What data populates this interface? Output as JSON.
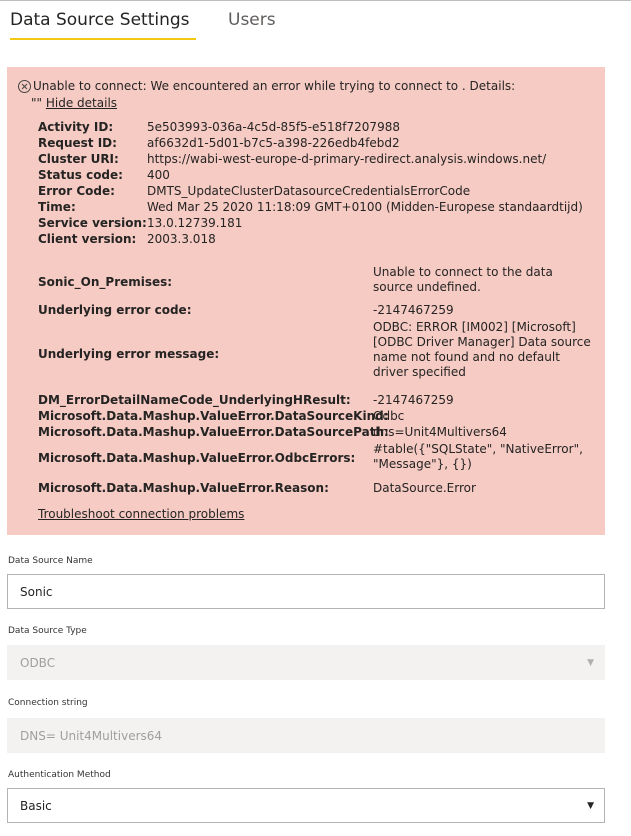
{
  "tabs": [
    {
      "label": "Data Source Settings",
      "active": true
    },
    {
      "label": "Users",
      "active": false
    }
  ],
  "error": {
    "message_line1": "Unable to connect: We encountered an error while trying to connect to . Details:",
    "message_line2_prefix": "\"\"",
    "hide_details": "Hide details",
    "fields": [
      {
        "label": "Activity ID:",
        "value": "5e503993-036a-4c5d-85f5-e518f7207988"
      },
      {
        "label": "Request ID:",
        "value": "af6632d1-5d01-b7c5-a398-226edb4febd2"
      },
      {
        "label": "Cluster URI:",
        "value": "https://wabi-west-europe-d-primary-redirect.analysis.windows.net/"
      },
      {
        "label": "Status code:",
        "value": "400"
      },
      {
        "label": "Error Code:",
        "value": "DMTS_UpdateClusterDatasourceCredentialsErrorCode"
      },
      {
        "label": "Time:",
        "value": "Wed Mar 25 2020 11:18:09 GMT+0100 (Midden-Europese standaardtijd)"
      },
      {
        "label": "Service version:",
        "value": "13.0.12739.181"
      },
      {
        "label": "Client version:",
        "value": "2003.3.018"
      }
    ],
    "details": [
      {
        "label": "Sonic_On_Premises:",
        "value": "Unable to connect to the data source undefined."
      },
      {
        "label": "Underlying error code:",
        "value": "-2147467259"
      },
      {
        "label": "Underlying error message:",
        "value": "ODBC: ERROR [IM002] [Microsoft] [ODBC Driver Manager] Data source name not found and no default driver specified"
      },
      {
        "label": "DM_ErrorDetailNameCode_UnderlyingHResult:",
        "value": "-2147467259"
      },
      {
        "label": "Microsoft.Data.Mashup.ValueError.DataSourceKind:",
        "value": "Odbc"
      },
      {
        "label": "Microsoft.Data.Mashup.ValueError.DataSourcePath:",
        "value": "dns=Unit4Multivers64"
      },
      {
        "label": "Microsoft.Data.Mashup.ValueError.OdbcErrors:",
        "value": "#table({\"SQLState\", \"NativeError\", \"Message\"}, {})"
      },
      {
        "label": "Microsoft.Data.Mashup.ValueError.Reason:",
        "value": "DataSource.Error"
      }
    ],
    "troubleshoot": "Troubleshoot connection problems"
  },
  "form": {
    "data_source_name": {
      "label": "Data Source Name",
      "value": "Sonic"
    },
    "data_source_type": {
      "label": "Data Source Type",
      "value": "ODBC"
    },
    "connection_string": {
      "label": "Connection string",
      "value": "DNS= Unit4Multivers64"
    },
    "auth_method": {
      "label": "Authentication Method",
      "value": "Basic"
    }
  }
}
